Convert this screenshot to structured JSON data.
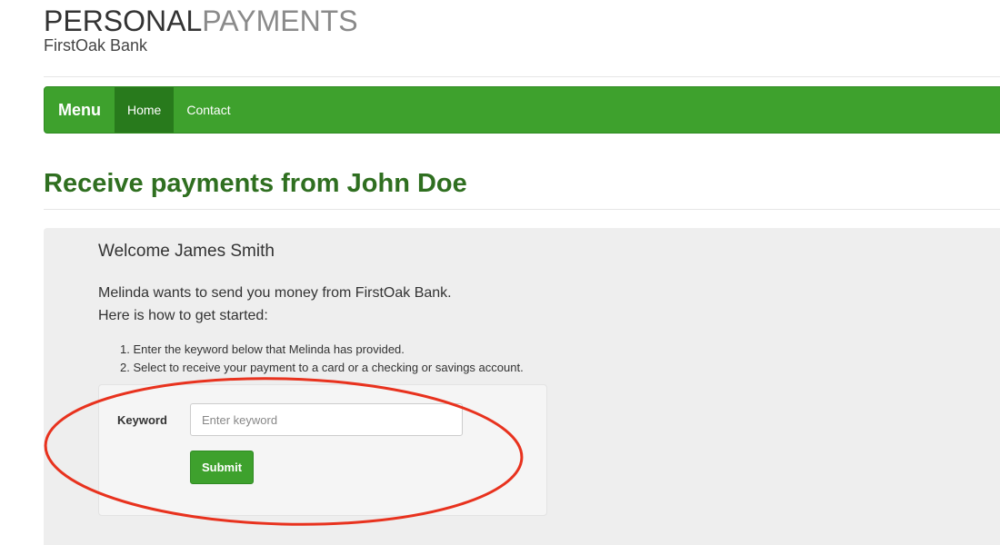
{
  "brand": {
    "title_part1": "PERSONAL",
    "title_part2": "PAYMENTS",
    "subtitle": "FirstOak Bank"
  },
  "navbar": {
    "brand_label": "Menu",
    "items": [
      {
        "label": "Home",
        "active": true
      },
      {
        "label": "Contact",
        "active": false
      }
    ]
  },
  "page": {
    "title": "Receive payments from John Doe"
  },
  "content": {
    "welcome": "Welcome James Smith",
    "intro_line1": "Melinda wants to send you money from FirstOak Bank.",
    "intro_line2": "Here is how to get started:",
    "steps": [
      "1. Enter the keyword below that Melinda has provided.",
      "2. Select to receive your payment to a card or a checking or savings account."
    ]
  },
  "form": {
    "keyword_label": "Keyword",
    "keyword_value": "",
    "keyword_placeholder": "Enter keyword",
    "submit_label": "Submit"
  },
  "colors": {
    "nav_green": "#3ea12d",
    "nav_active": "#287a1c",
    "title_green": "#2f6f20",
    "annotation_red": "#e8321e"
  }
}
